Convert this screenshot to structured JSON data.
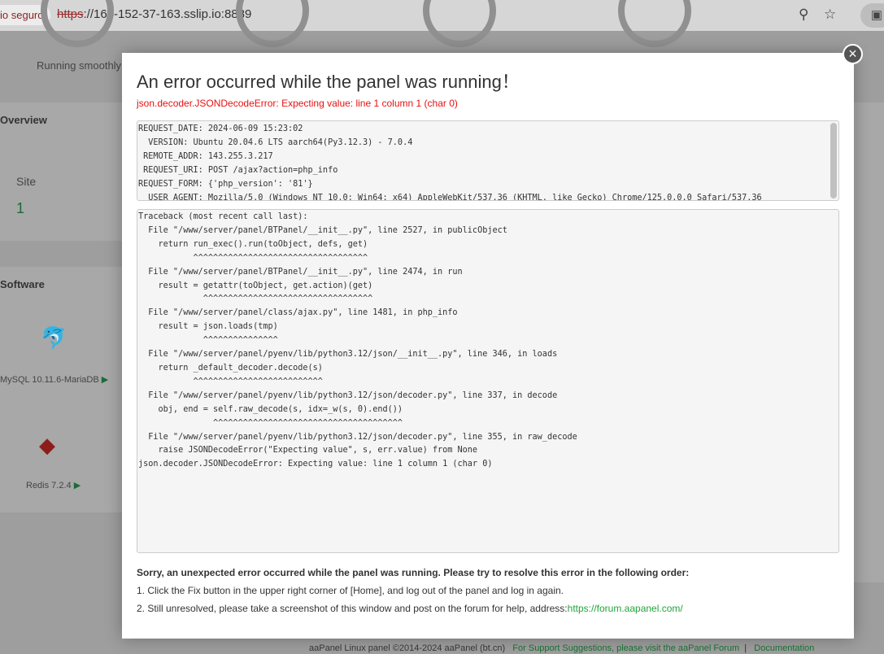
{
  "browser": {
    "security_label": "io seguro",
    "url_scheme": "https",
    "url_rest": "://164-152-37-163.sslip.io:8889"
  },
  "background": {
    "status": "Running smoothly",
    "overview": "Overview",
    "site_label": "Site",
    "site_count": "1",
    "software": "Software",
    "mysql": "MySQL 10.11.6-MariaDB",
    "redis": "Redis 7.2.4"
  },
  "modal": {
    "title": "An error occurred while the panel was running！",
    "error": "json.decoder.JSONDecodeError: Expecting value: line 1 column 1 (char 0)",
    "request_info": "REQUEST_DATE: 2024-06-09 15:23:02\n  VERSION: Ubuntu 20.04.6 LTS aarch64(Py3.12.3) - 7.0.4\n REMOTE_ADDR: 143.255.3.217\n REQUEST_URI: POST /ajax?action=php_info\nREQUEST_FORM: {'php_version': '81'}\n  USER_AGENT: Mozilla/5.0 (Windows NT 10.0; Win64; x64) AppleWebKit/537.36 (KHTML, like Gecko) Chrome/125.0.0.0 Safari/537.36",
    "traceback": "Traceback (most recent call last):\n  File \"/www/server/panel/BTPanel/__init__.py\", line 2527, in publicObject\n    return run_exec().run(toObject, defs, get)\n           ^^^^^^^^^^^^^^^^^^^^^^^^^^^^^^^^^^^\n  File \"/www/server/panel/BTPanel/__init__.py\", line 2474, in run\n    result = getattr(toObject, get.action)(get)\n             ^^^^^^^^^^^^^^^^^^^^^^^^^^^^^^^^^^\n  File \"/www/server/panel/class/ajax.py\", line 1481, in php_info\n    result = json.loads(tmp)\n             ^^^^^^^^^^^^^^^\n  File \"/www/server/panel/pyenv/lib/python3.12/json/__init__.py\", line 346, in loads\n    return _default_decoder.decode(s)\n           ^^^^^^^^^^^^^^^^^^^^^^^^^^\n  File \"/www/server/panel/pyenv/lib/python3.12/json/decoder.py\", line 337, in decode\n    obj, end = self.raw_decode(s, idx=_w(s, 0).end())\n               ^^^^^^^^^^^^^^^^^^^^^^^^^^^^^^^^^^^^^^\n  File \"/www/server/panel/pyenv/lib/python3.12/json/decoder.py\", line 355, in raw_decode\n    raise JSONDecodeError(\"Expecting value\", s, err.value) from None\njson.decoder.JSONDecodeError: Expecting value: line 1 column 1 (char 0)",
    "help_title": "Sorry, an unexpected error occurred while the panel was running. Please try to resolve this error in the following order:",
    "help_1": "1. Click the Fix button in the upper right corner of [Home], and log out of the panel and log in again.",
    "help_2": "2. Still unresolved, please take a screenshot of this window and post on the forum for help, address:",
    "forum_link": "https://forum.aapanel.com/",
    "close": "×"
  },
  "footer": {
    "copyright": "aaPanel Linux panel ©2014-2024 aaPanel (bt.cn)",
    "support": "For Support Suggestions, please visit the aaPanel Forum",
    "docs": "Documentation"
  }
}
